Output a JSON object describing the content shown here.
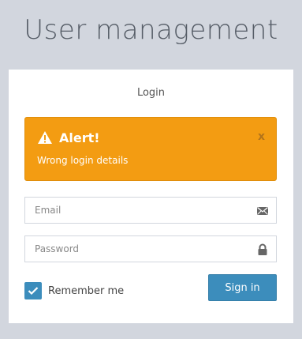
{
  "page": {
    "title": "User management"
  },
  "login": {
    "title": "Login",
    "alert": {
      "title": "Alert!",
      "message": "Wrong login details",
      "close_label": "x",
      "icon": "warning-icon",
      "color": "#f39c12"
    },
    "email": {
      "placeholder": "Email",
      "value": "",
      "icon": "envelope-icon"
    },
    "password": {
      "placeholder": "Password",
      "value": "",
      "icon": "lock-icon"
    },
    "remember": {
      "label": "Remember me",
      "checked": true
    },
    "submit_label": "Sign in",
    "accent_color": "#3c8dbc"
  }
}
